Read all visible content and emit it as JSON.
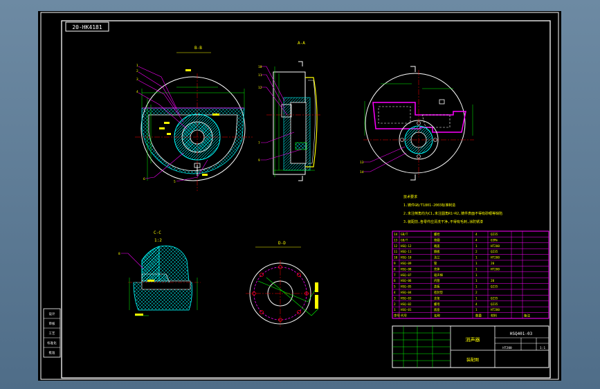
{
  "drawing": {
    "top_label": "20-HK4181",
    "view_labels": {
      "section_main": "B-B",
      "section_side": "A-A",
      "detail_c": "C-C",
      "detail_scale": "1:2",
      "detail_d": "D-D"
    },
    "notes": {
      "title": "技术要求",
      "lines": [
        "1.铸件GB/T1801-2003标准制造",
        "2.未注倒角均为C1,未注圆角R1~R2,铸件表面不得有砂眼等缺陷",
        "3.装配前,各零件应清洗干净,不得有毛刺,涂防锈漆"
      ]
    },
    "title_block": {
      "part_name": "消声器",
      "drawing_no": "HSQ401-03",
      "material": "HT200",
      "scale": "1:1",
      "assembly_label": "装配图"
    },
    "bom_headers": [
      "序号",
      "代号",
      "名称",
      "数量",
      "材料",
      "备注"
    ],
    "bom_rows": [
      [
        "14",
        "GB/T",
        "螺栓",
        "4",
        "Q235",
        ""
      ],
      [
        "13",
        "GB/T",
        "垫圈",
        "4",
        "65Mn",
        ""
      ],
      [
        "12",
        "HSQ-12",
        "端盖",
        "1",
        "HT200",
        ""
      ],
      [
        "11",
        "HSQ-11",
        "隔板",
        "2",
        "Q235",
        ""
      ],
      [
        "10",
        "HSQ-10",
        "法兰",
        "1",
        "HT200",
        ""
      ],
      [
        "9",
        "HSQ-09",
        "管",
        "1",
        "20",
        ""
      ],
      [
        "8",
        "HSQ-08",
        "壳体",
        "1",
        "HT200",
        ""
      ],
      [
        "7",
        "HSQ-07",
        "吸声棉",
        "1",
        "",
        ""
      ],
      [
        "6",
        "HSQ-06",
        "内管",
        "1",
        "20",
        ""
      ],
      [
        "5",
        "HSQ-05",
        "盖板",
        "1",
        "Q235",
        ""
      ],
      [
        "4",
        "HSQ-04",
        "密封垫",
        "2",
        "",
        ""
      ],
      [
        "3",
        "HSQ-03",
        "支架",
        "1",
        "Q235",
        ""
      ],
      [
        "2",
        "HSQ-02",
        "螺母",
        "4",
        "Q235",
        ""
      ],
      [
        "1",
        "HSQ-01",
        "底座",
        "1",
        "HT200",
        ""
      ]
    ],
    "side_block": [
      "设计",
      "审核",
      "工艺",
      "标准化",
      "批准"
    ],
    "colors": {
      "background": "#000000",
      "frame": "#ffffff",
      "geometry": "#ffffff",
      "dimension": "#00ff00",
      "hatch": "#00ffff",
      "table": "#ff00ff",
      "text": "#ffff00",
      "centerline": "#ff0000",
      "leader": "#ff00ff"
    }
  }
}
